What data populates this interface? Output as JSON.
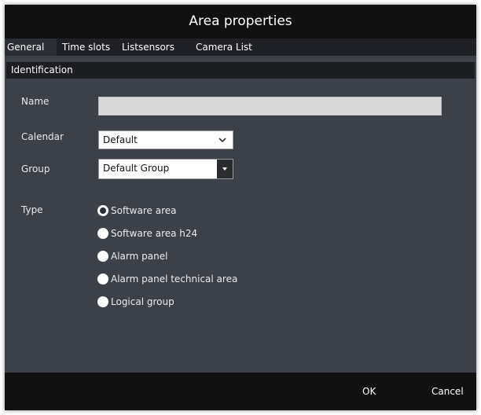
{
  "dialog": {
    "title": "Area properties"
  },
  "tabs": [
    {
      "label": "General",
      "active": true
    },
    {
      "label": "Time slots",
      "active": false
    },
    {
      "label": "Listsensors",
      "active": false
    },
    {
      "label": "Camera List",
      "active": false
    }
  ],
  "section": {
    "title": "Identification"
  },
  "form": {
    "name": {
      "label": "Name",
      "value": ""
    },
    "calendar": {
      "label": "Calendar",
      "selected": "Default",
      "icon": "chevron-down-icon"
    },
    "group": {
      "label": "Group",
      "selected": "Default Group",
      "icon": "dropdown-arrow-icon"
    },
    "type": {
      "label": "Type",
      "options": [
        {
          "label": "Software area",
          "checked": true
        },
        {
          "label": "Software area h24",
          "checked": false
        },
        {
          "label": "Alarm panel",
          "checked": false
        },
        {
          "label": "Alarm panel technical area",
          "checked": false
        },
        {
          "label": "Logical group",
          "checked": false
        }
      ]
    }
  },
  "footer": {
    "ok_label": "OK",
    "cancel_label": "Cancel"
  },
  "colors": {
    "dialog_bg": "#3b4049",
    "title_bg": "#111111",
    "tabbar_bg": "#1f2126",
    "section_bg": "#1b1d21",
    "input_bg": "#d9d9d9"
  }
}
